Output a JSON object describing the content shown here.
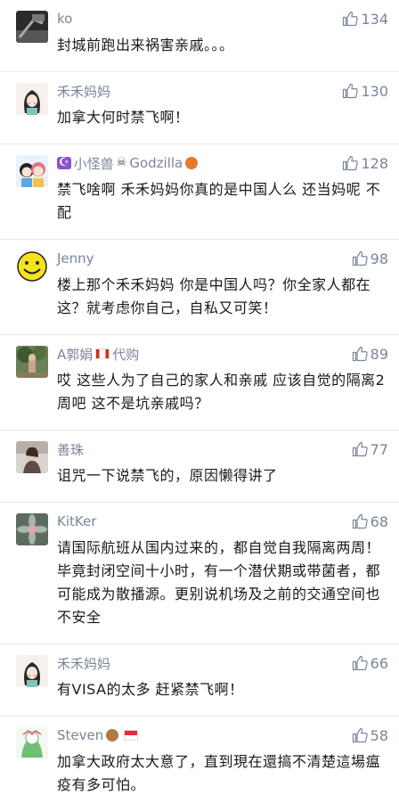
{
  "comments": [
    {
      "username": "ko",
      "likes": "134",
      "text": "封城前跑出来祸害亲戚。。。",
      "avatar": "photo-dark"
    },
    {
      "username": "禾禾妈妈",
      "likes": "130",
      "text": "加拿大何时禁飞啊！",
      "avatar": "girl-drawing"
    },
    {
      "username_prefix": "小怪兽",
      "username_suffix": "Godzilla",
      "badge_left": "☪",
      "badge_mid": "☠",
      "badge_right": "🏀",
      "likes": "128",
      "text": "禁飞啥啊 禾禾妈妈你真的是中国人么 还当妈呢 不配",
      "avatar": "cartoon-couple"
    },
    {
      "username": "Jenny",
      "likes": "98",
      "text": "楼上那个禾禾妈妈 你是中国人吗？你全家人都在这？就考虑你自己，自私又可笑！",
      "avatar": "smiley"
    },
    {
      "username_prefix": "A郭娟",
      "username_suffix": "代购",
      "likes": "89",
      "text": "哎 这些人为了自己的家人和亲戚 应该自觉的隔离2周吧 这不是坑亲戚吗？",
      "avatar": "photo-tree"
    },
    {
      "username": "善珠",
      "likes": "77",
      "text": "诅咒一下说禁飞的，原因懒得讲了",
      "avatar": "photo-person"
    },
    {
      "username": "KitKer",
      "likes": "68",
      "text": "请国际航班从国内过来的，都自觉自我隔离两周！毕竟封闭空间十小时，有一个潜伏期或带菌者，都可能成为散播源。更别说机场及之前的交通空间也不安全",
      "avatar": "photo-succulent"
    },
    {
      "username": "禾禾妈妈",
      "likes": "66",
      "text": "有VISA的太多 赶紧禁飞啊！",
      "avatar": "girl-drawing"
    },
    {
      "username": "Steven",
      "likes": "58",
      "text": "加拿大政府太大意了，直到現在還搞不清楚這場瘟疫有多可怕。",
      "avatar": "cartoon-green"
    }
  ],
  "icons": {
    "like": "thumbs-up-icon"
  },
  "colors": {
    "name": "#7a8599",
    "text": "#1a1a1a",
    "divider": "#e8e8e8"
  }
}
